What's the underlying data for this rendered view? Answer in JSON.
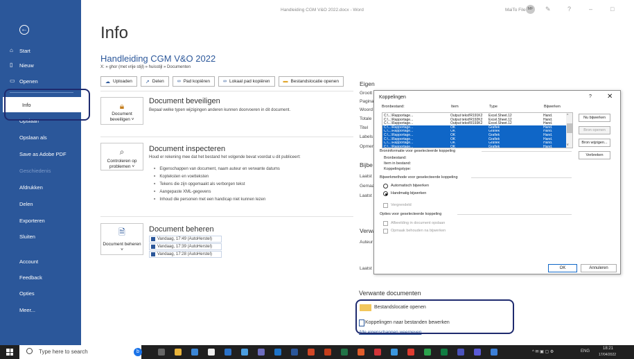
{
  "window": {
    "title": "Handleiding CGM V&O 2022.docx  -  Word",
    "user": "MaiTo File",
    "avatar": "MF",
    "controls": [
      "?",
      "–",
      "□"
    ]
  },
  "sidebar": {
    "back_icon": "arrow-left-icon",
    "items": [
      {
        "label": "Start",
        "icon": "home-icon"
      },
      {
        "label": "Nieuw",
        "icon": "new-doc-icon"
      },
      {
        "label": "Openen",
        "icon": "folder-icon"
      },
      {
        "label": "Info"
      },
      {
        "label": "Opslaan"
      },
      {
        "label": "Opslaan als"
      },
      {
        "label": "Save as Adobe PDF"
      },
      {
        "label": "Geschiedenis"
      },
      {
        "label": "Afdrukken"
      },
      {
        "label": "Delen"
      },
      {
        "label": "Exporteren"
      },
      {
        "label": "Sluiten"
      },
      {
        "label": "Account"
      },
      {
        "label": "Feedback"
      },
      {
        "label": "Opties"
      },
      {
        "label": "Meer..."
      }
    ]
  },
  "main": {
    "title": "Info",
    "doc_title": "Handleiding CGM V&O 2022",
    "path": "X: » ghor (met vrije stijl) » huisstijl » Documenten",
    "buttons": [
      "Uploaden",
      "Delen",
      "Pad kopiëren",
      "Lokaal pad kopiëren",
      "Bestandslocatie openen"
    ],
    "protect": {
      "card": "Document beveiligen ˅",
      "title": "Document beveiligen",
      "desc": "Bepaal welke typen wijzigingen anderen kunnen doorvoeren in dit document."
    },
    "inspect": {
      "card": "Controleren op problemen ˅",
      "title": "Document inspecteren",
      "desc": "Houd er rekening mee dat het bestand het volgende bevat voordat u dit publiceert:",
      "bullets": [
        "Eigenschappen van document, naam auteur en verwante datums",
        "Kopteksten en voetteksten",
        "Tekens die zijn opgemaakt als verborgen tekst",
        "Aangepaste XML-gegevens",
        "Inhoud die personen met een handicap niet kunnen lezen"
      ]
    },
    "manage": {
      "card": "Document beheren ˅",
      "title": "Document beheren",
      "versions": [
        "Vandaag, 17:49 (AutoHerstel)",
        "Vandaag, 17:39 (AutoHerstel)",
        "Vandaag, 17:28 (AutoHerstel)"
      ]
    }
  },
  "props": {
    "labels": [
      "Eigen",
      "Groott",
      "Pagina",
      "Woord",
      "Totale",
      "Titel",
      "Labels",
      "Opmer",
      "Bijbe",
      "Laatst",
      "Gemaa",
      "Laatst",
      "Verwa",
      "Auteur",
      "Laatst"
    ]
  },
  "related": {
    "title": "Verwante documenten",
    "links": [
      "Bestandslocatie openen",
      "Koppelingen naar bestanden bewerken",
      "Alle eigenschappen weergeven"
    ]
  },
  "dialog": {
    "title": "Koppelingen",
    "help": "?",
    "close": "✕",
    "columns": [
      "Bronbestand:",
      "Item",
      "Type",
      "Bijwerken"
    ],
    "rows": [
      {
        "src": "C:\\...\\Rapportage...",
        "item": "Output tekst!R191K2",
        "type": "Excel.Sheet.12",
        "upd": "Hand.",
        "sel": false
      },
      {
        "src": "C:\\...\\Rapportage...",
        "item": "Output tekst!R192K2",
        "type": "Excel.Sheet.12",
        "upd": "Hand.",
        "sel": false
      },
      {
        "src": "C:\\...\\Rapportage...",
        "item": "Output tekst!R193K2",
        "type": "Excel.Sheet.12",
        "upd": "Hand.",
        "sel": false
      },
      {
        "src": "C:\\...\\Rapportage...",
        "item": "OK",
        "type": "Grafiek",
        "upd": "Hand.",
        "sel": true
      },
      {
        "src": "C:\\...\\Rapportage...",
        "item": "OK",
        "type": "Grafiek",
        "upd": "Hand.",
        "sel": true
      },
      {
        "src": "C:\\...\\Rapportage...",
        "item": "OK",
        "type": "Grafiek",
        "upd": "Hand.",
        "sel": true
      },
      {
        "src": "C:\\...\\Rapportage...",
        "item": "OK",
        "type": "Grafiek",
        "upd": "Hand.",
        "sel": true
      },
      {
        "src": "C:\\...\\Rapportage...",
        "item": "OK",
        "type": "Grafiek",
        "upd": "Hand.",
        "sel": true
      },
      {
        "src": "C:\\...\\Rapportage...",
        "item": "OK",
        "type": "Grafiek",
        "upd": "Hand.",
        "sel": true
      }
    ],
    "side_buttons": [
      "Nu bijwerken",
      "Bron openen",
      "Bron wijzigen...",
      "Verbreken"
    ],
    "info_header": "Broninformatie voor geselecteerde koppeling",
    "info": [
      "Bronbestand:",
      "Item in bestand:",
      "Koppelingstype:"
    ],
    "method_header": "Bijwerkmethode voor geselecteerde koppeling",
    "method": [
      "Automatisch bijwerken",
      "Handmatig bijwerken",
      "Vergrendeld"
    ],
    "options_header": "Opties voor geselecteerde koppeling",
    "options": [
      "Afbeelding in document opslaan",
      "Opmaak behouden na bijwerken"
    ],
    "ok": "OK",
    "cancel": "Annuleren"
  },
  "taskbar": {
    "search": "Type here to search",
    "lang": "ENG",
    "time": "18:21",
    "date": "17/04/2022"
  }
}
